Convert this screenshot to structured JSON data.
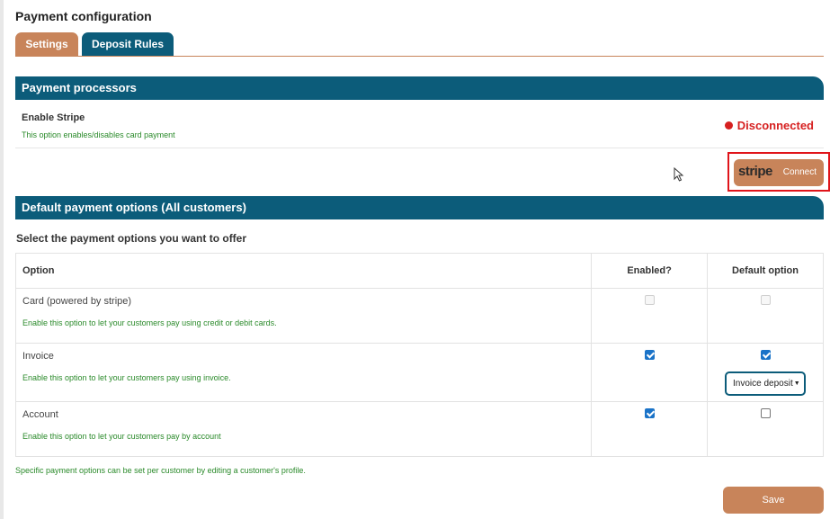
{
  "page": {
    "title": "Payment configuration"
  },
  "tabs": [
    {
      "label": "Settings",
      "active": true
    },
    {
      "label": "Deposit Rules",
      "active": false
    }
  ],
  "processors": {
    "section_title": "Payment processors",
    "stripe_label": "Enable Stripe",
    "stripe_hint": "This option enables/disables card payment",
    "status": "Disconnected",
    "status_color": "#d62020",
    "connect_brand": "stripe",
    "connect_label": "Connect"
  },
  "default_options": {
    "section_title": "Default payment options (All customers)",
    "prompt": "Select the payment options you want to offer",
    "columns": {
      "option": "Option",
      "enabled": "Enabled?",
      "default": "Default option"
    },
    "rows": [
      {
        "name": "Card (powered by stripe)",
        "hint": "Enable this option to let your customers pay using credit or debit cards.",
        "enabled": false,
        "default": false,
        "disabled": true
      },
      {
        "name": "Invoice",
        "hint": "Enable this option to let your customers pay using invoice.",
        "enabled": true,
        "default": true,
        "select_value": "Invoice deposit"
      },
      {
        "name": "Account",
        "hint": "Enable this option to let your customers pay by account",
        "enabled": true,
        "default": false
      }
    ]
  },
  "footer": {
    "note": "Specific payment options can be set per customer by editing a customer's profile.",
    "save_label": "Save"
  },
  "colors": {
    "accent": "#c8845a",
    "brand": "#0c5c7a",
    "hint_green": "#2a8a2a"
  }
}
